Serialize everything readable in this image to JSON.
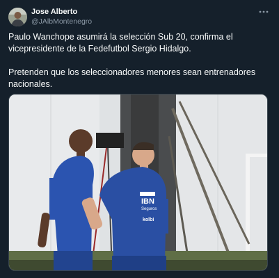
{
  "post": {
    "author_name": "Jose Alberto",
    "author_handle": "@JAlbMontenegro",
    "paragraphs": [
      "Paulo Wanchope asumirá la selección Sub 20, confirma el vicepresidente de la Fedefutbol Sergio Hidalgo.",
      "Pretenden que los seleccionadores menores sean entrenadores nacionales."
    ],
    "more_icon": "more-horizontal-icon",
    "avatar_icon": "user-avatar"
  },
  "media": {
    "jersey_sponsor": "IBN",
    "jersey_sponsor_sub": "Seguros",
    "jersey_sponsor_2": "kolbi"
  },
  "colors": {
    "background": "#15202b",
    "text": "#f7f9f9",
    "muted": "#8b98a5",
    "border": "#38444d",
    "jersey": "#2a4fa3"
  }
}
